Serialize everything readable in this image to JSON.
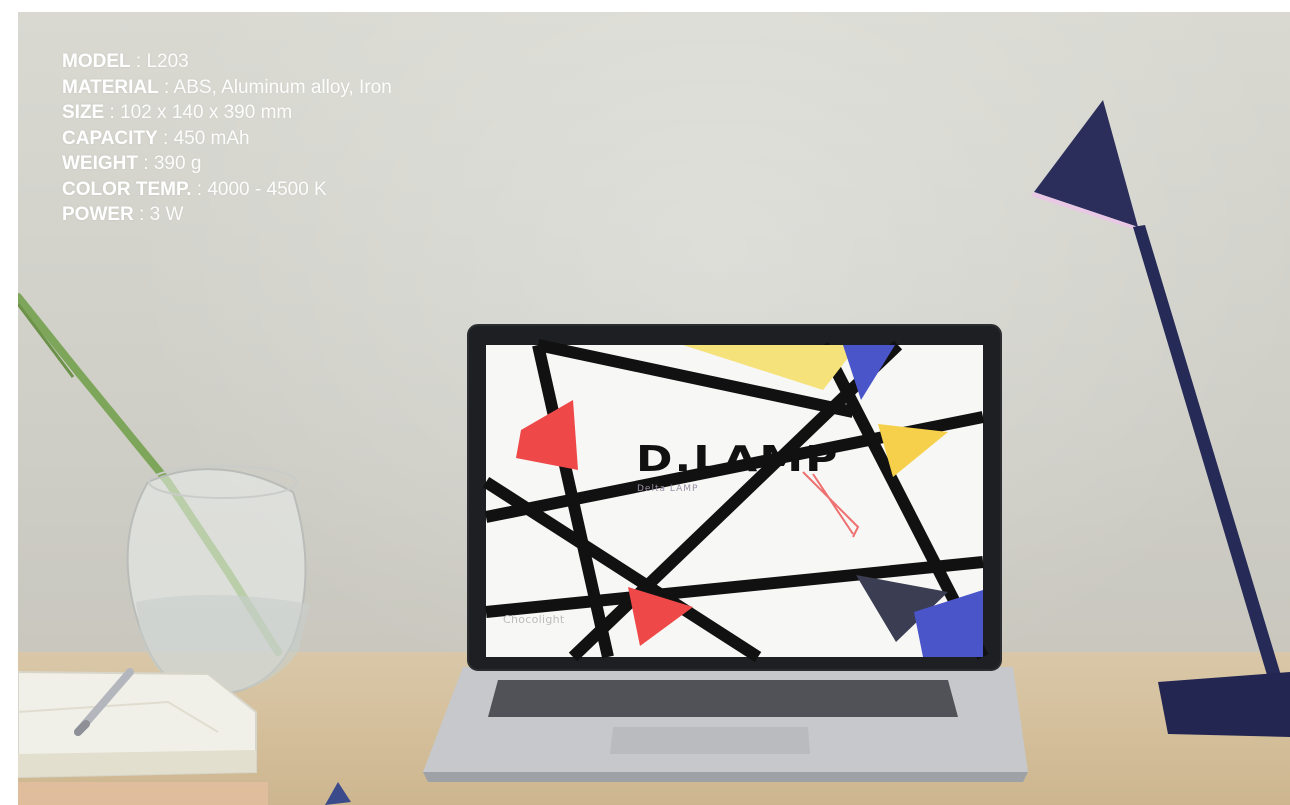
{
  "specs": [
    {
      "label": "MODEL",
      "value": "L203"
    },
    {
      "label": "MATERIAL",
      "value": "ABS, Aluminum alloy, Iron"
    },
    {
      "label": "SIZE",
      "value": "102 x 140 x 390 mm"
    },
    {
      "label": "CAPACITY",
      "value": "450 mAh"
    },
    {
      "label": "WEIGHT",
      "value": "390 g"
    },
    {
      "label": "COLOR TEMP.",
      "value": "4000 - 4500 K"
    },
    {
      "label": "POWER",
      "value": "3 W"
    }
  ],
  "separator": ":",
  "screen": {
    "logo": "D.LAMP",
    "subtitle": "Delta LAMP",
    "brand": "Chocolight"
  },
  "colors": {
    "lamp": "#2b2e5a",
    "wall": "#d4d4cd",
    "desk": "#d6c29f",
    "red_accent": "#ee4848",
    "yellow_accent": "#f6e27a",
    "blue_accent": "#4a55c9"
  },
  "icons": {
    "pencil": "pencil-icon"
  }
}
